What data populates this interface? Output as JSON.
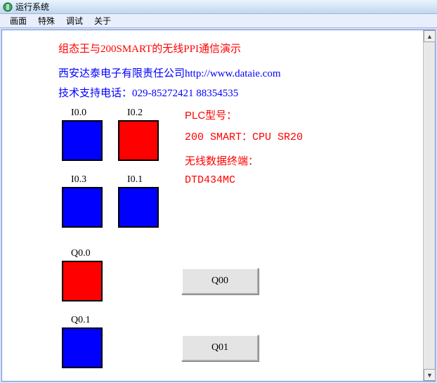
{
  "window": {
    "title": "运行系统"
  },
  "menu": {
    "item1": "画面",
    "item2": "特殊",
    "item3": "调试",
    "item4": "关于"
  },
  "heading": "组态王与200SMART的无线PPI通信演示",
  "company": "西安达泰电子有限责任公司http://www.dataie.com",
  "support": "技术支持电话：029-85272421 88354535",
  "io": {
    "i00": "I0.0",
    "i02": "I0.2",
    "i03": "I0.3",
    "i01": "I0.1",
    "q00": "Q0.0",
    "q01": "Q0.1"
  },
  "plc": {
    "label": "PLC型号：",
    "value": "200 SMART：CPU SR20"
  },
  "wireless": {
    "label": "无线数据终端：",
    "value": "DTD434MC"
  },
  "buttons": {
    "q00": "Q00",
    "q01": "Q01"
  },
  "chart_data": {
    "type": "table",
    "title": "PLC IO Status",
    "series": [
      {
        "name": "I0.0",
        "state": "off",
        "color": "blue"
      },
      {
        "name": "I0.2",
        "state": "on",
        "color": "red"
      },
      {
        "name": "I0.3",
        "state": "off",
        "color": "blue"
      },
      {
        "name": "I0.1",
        "state": "off",
        "color": "blue"
      },
      {
        "name": "Q0.0",
        "state": "on",
        "color": "red"
      },
      {
        "name": "Q0.1",
        "state": "off",
        "color": "blue"
      }
    ]
  }
}
